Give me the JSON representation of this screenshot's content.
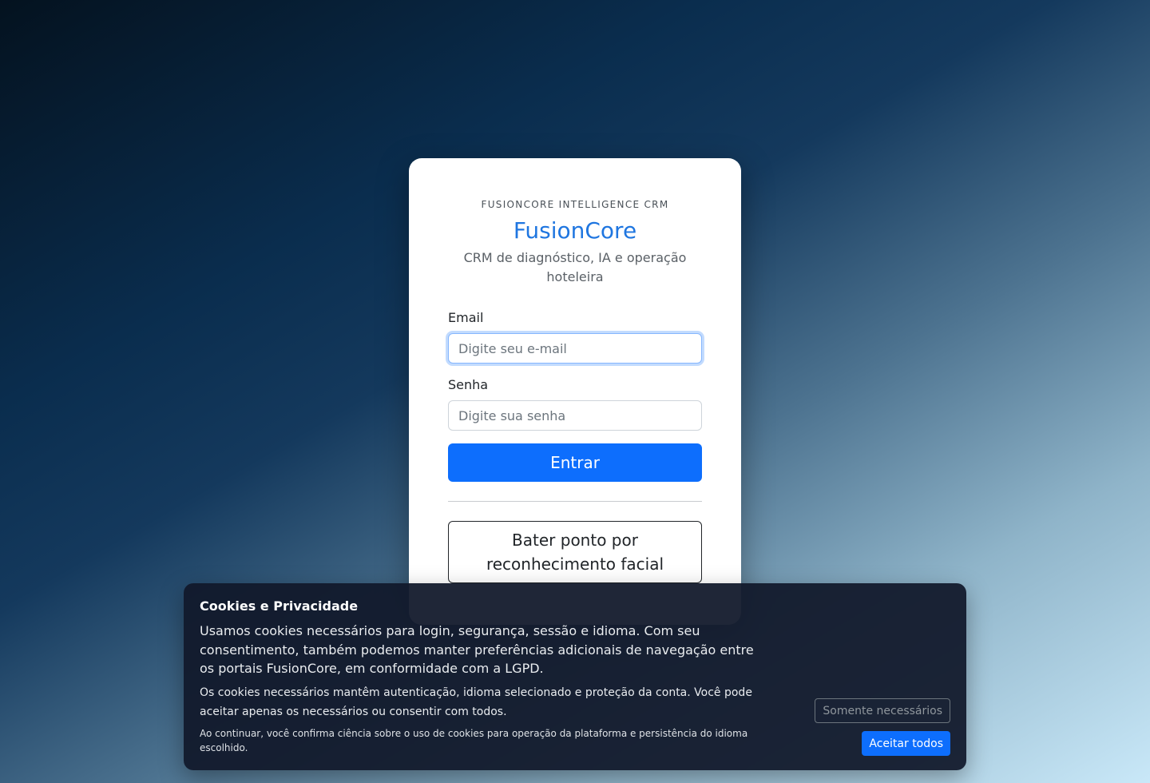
{
  "login": {
    "eyebrow": "FUSIONCORE INTELLIGENCE CRM",
    "brand": "FusionCore",
    "tagline": "CRM de diagnóstico, IA e operação hoteleira",
    "email_label": "Email",
    "email_placeholder": "Digite seu e-mail",
    "email_value": "",
    "password_label": "Senha",
    "password_placeholder": "Digite sua senha",
    "password_value": "",
    "submit_label": "Entrar",
    "facial_button_label": "Bater ponto por reconhecimento facial"
  },
  "cookies": {
    "title": "Cookies e Privacidade",
    "text": "Usamos cookies necessários para login, segurança, sessão e idioma. Com seu consentimento, também podemos manter preferências adicionais de navegação entre os portais FusionCore, em conformidade com a LGPD.",
    "detail": "Os cookies necessários mantêm autenticação, idioma selecionado e proteção da conta. Você pode aceitar apenas os necessários ou consentir com todos.",
    "notice": "Ao continuar, você confirma ciência sobre o uso de cookies para operação da plataforma e persistência do idioma escolhido.",
    "necessary_label": "Somente necessários",
    "accept_label": "Aceitar todos"
  },
  "colors": {
    "brand": "#1f76e0",
    "primary": "#0d6efd",
    "banner_bg": "#11182b"
  }
}
